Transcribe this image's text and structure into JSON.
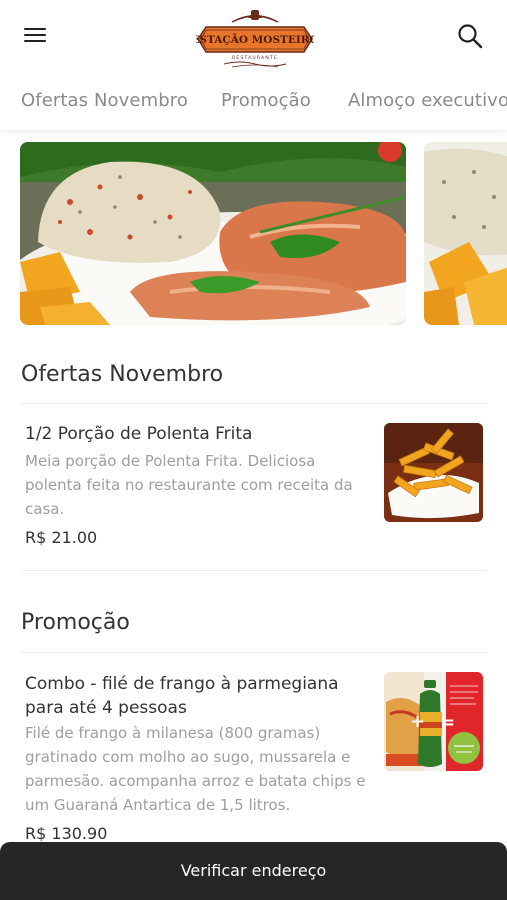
{
  "header": {
    "logo_text": "ESTAÇÃO MOSTEIRO",
    "logo_subtext": "RESTAURANTE",
    "menu_icon": "hamburger-menu-icon",
    "search_icon": "search-icon"
  },
  "tabs": [
    {
      "label": "Ofertas Novembro"
    },
    {
      "label": "Promoção"
    },
    {
      "label": "Almoço executivo"
    }
  ],
  "banners": [
    {
      "image": "grilled-salmon-rice-banner"
    },
    {
      "image": "rice-polenta-banner"
    }
  ],
  "sections": [
    {
      "title": "Ofertas Novembro",
      "items": [
        {
          "name": "1/2 Porção de Polenta Frita",
          "description": "Meia porção de Polenta Frita. Deliciosa polenta feita no restaurante com receita da casa.",
          "price": "R$ 21.00",
          "image": "fried-polenta-thumbnail"
        }
      ]
    },
    {
      "title": "Promoção",
      "items": [
        {
          "name": "Combo - filé de frango à parmegiana para até 4 pessoas",
          "description": "Filé de frango à milanesa (800 gramas) gratinado com molho ao sugo, mussarela e parmesão. acompanha arroz e batata chips e um Guaraná Antartica de 1,5 litros.",
          "price": "R$ 130.90",
          "image": "chicken-parmegiana-combo-thumbnail"
        }
      ]
    }
  ],
  "footer": {
    "cta_label": "Verificar endereço"
  },
  "colors": {
    "logo_orange": "#e8762a",
    "logo_brown": "#6b2a1a",
    "bottom_bar": "#262626",
    "tab_text": "#8a8a8a",
    "description_text": "#9e9e9e"
  }
}
